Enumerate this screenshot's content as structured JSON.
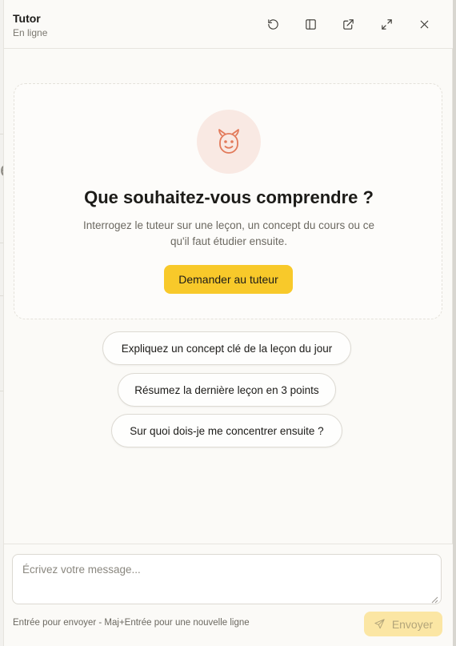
{
  "header": {
    "title": "Tutor",
    "status": "En ligne",
    "icons": [
      "reset-icon",
      "sidebar-icon",
      "external-link-icon",
      "expand-icon",
      "close-icon"
    ]
  },
  "welcome": {
    "avatar_icon": "tutor-face-icon",
    "title": "Que souhaitez-vous comprendre ?",
    "subtitle": "Interrogez le tuteur sur une leçon, un concept du cours ou ce qu'il faut étudier ensuite.",
    "cta_label": "Demander au tuteur"
  },
  "suggestions": [
    {
      "label": "Expliquez un concept clé de la leçon du jour"
    },
    {
      "label": "Résumez la dernière leçon en 3 points"
    },
    {
      "label": "Sur quoi dois-je me concentrer ensuite ?"
    }
  ],
  "composer": {
    "placeholder": "Écrivez votre message...",
    "hint": "Entrée pour envoyer - Maj+Entrée pour une nouvelle ligne",
    "send_label": "Envoyer"
  },
  "colors": {
    "accent": "#f8c92a",
    "accent_disabled": "#fbe6a4",
    "avatar_bg": "#f9e9e3",
    "avatar_stroke": "#e27a5a",
    "panel_bg": "#fbfaf7"
  }
}
